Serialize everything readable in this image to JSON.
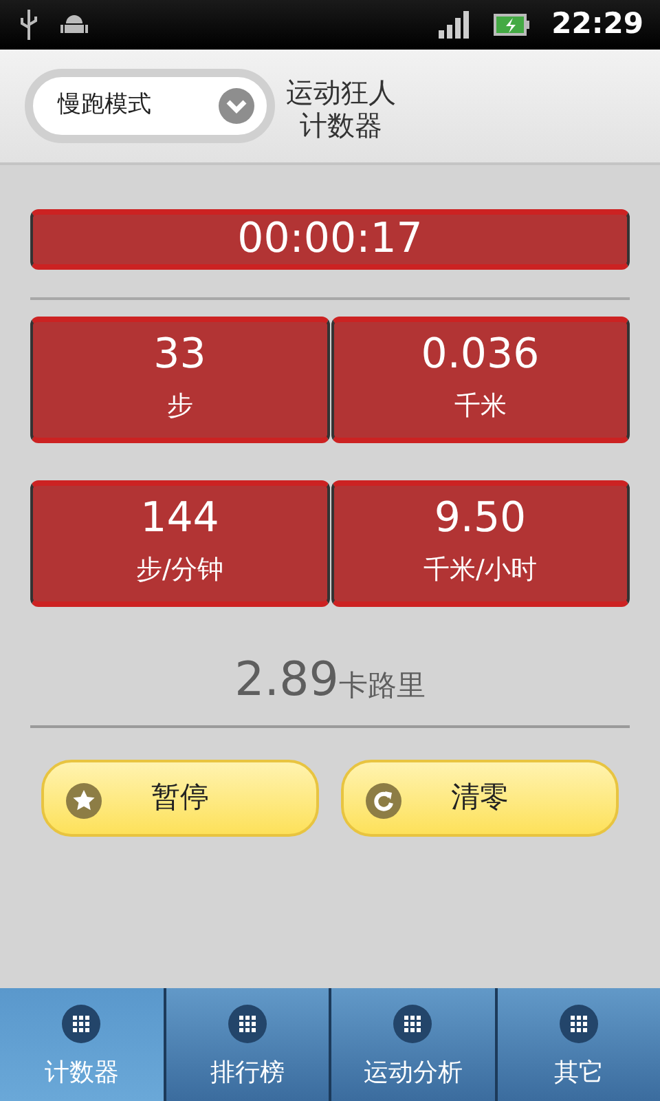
{
  "status_bar": {
    "time": "22:29"
  },
  "header": {
    "mode_select": {
      "value": "慢跑模式"
    },
    "title_lines": [
      "运动狂人",
      "计数器"
    ]
  },
  "timer": "00:00:17",
  "stats": [
    {
      "value": "33",
      "unit": "步"
    },
    {
      "value": "0.036",
      "unit": "千米"
    },
    {
      "value": "144",
      "unit": "步/分钟"
    },
    {
      "value": "9.50",
      "unit": "千米/小时"
    }
  ],
  "calories": {
    "value": "2.89",
    "unit": "卡路里"
  },
  "buttons": [
    {
      "label": "暂停",
      "kind": "pause"
    },
    {
      "label": "清零",
      "kind": "reset"
    }
  ],
  "tabs": [
    {
      "label": "计数器",
      "selected": true
    },
    {
      "label": "排行榜",
      "selected": false
    },
    {
      "label": "运动分析",
      "selected": false
    },
    {
      "label": "其它",
      "selected": false
    }
  ]
}
